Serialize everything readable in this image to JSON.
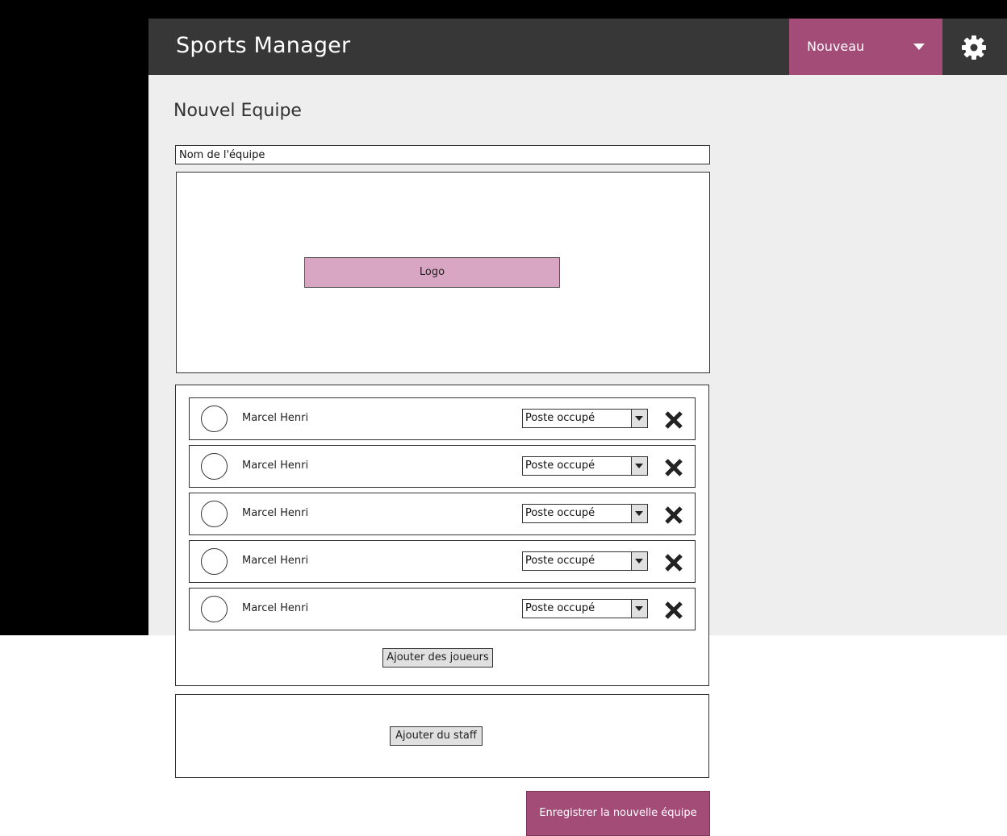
{
  "header": {
    "app_title": "Sports Manager",
    "new_menu_label": "Nouveau",
    "settings_icon": "gear-icon",
    "accent_color": "#a44c78"
  },
  "page": {
    "title": "Nouvel Equipe"
  },
  "form": {
    "team_name_placeholder": "Nom de l'équipe",
    "team_name_value": "",
    "logo_button_label": "Logo",
    "players": [
      {
        "name": "Marcel Henri",
        "role_selected": "Poste occupé"
      },
      {
        "name": "Marcel Henri",
        "role_selected": "Poste occupé"
      },
      {
        "name": "Marcel Henri",
        "role_selected": "Poste occupé"
      },
      {
        "name": "Marcel Henri",
        "role_selected": "Poste occupé"
      },
      {
        "name": "Marcel Henri",
        "role_selected": "Poste occupé"
      }
    ],
    "add_players_label": "Ajouter des joueurs",
    "add_staff_label": "Ajouter du staff",
    "save_label": "Enregistrer la nouvelle équipe"
  }
}
